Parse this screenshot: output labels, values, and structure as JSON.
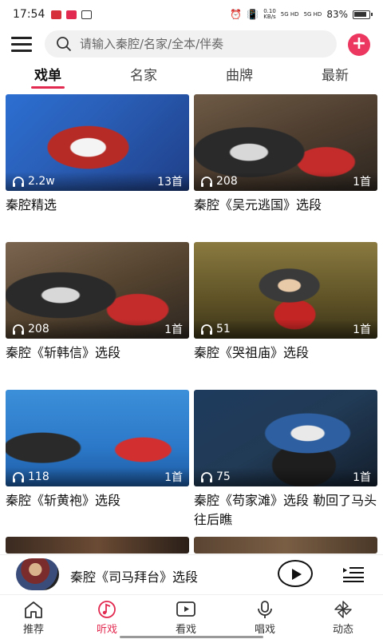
{
  "status_bar": {
    "time": "17:54",
    "net_speed_top": "0.10",
    "net_speed_unit": "KB/s",
    "signal1": "5G HD",
    "signal2": "5G HD",
    "battery": "83%"
  },
  "search": {
    "placeholder": "请输入秦腔/名家/全本/伴奏"
  },
  "tabs": [
    {
      "label": "戏单",
      "active": true
    },
    {
      "label": "名家",
      "active": false
    },
    {
      "label": "曲牌",
      "active": false
    },
    {
      "label": "最新",
      "active": false
    }
  ],
  "playlists": [
    {
      "listens": "2.2w",
      "count": "13首",
      "title": "秦腔精选"
    },
    {
      "listens": "208",
      "count": "1首",
      "title": "秦腔《吴元逃国》选段"
    },
    {
      "listens": "208",
      "count": "1首",
      "title": "秦腔《斩韩信》选段"
    },
    {
      "listens": "51",
      "count": "1首",
      "title": "秦腔《哭祖庙》选段"
    },
    {
      "listens": "118",
      "count": "1首",
      "title": "秦腔《斩黄袍》选段"
    },
    {
      "listens": "75",
      "count": "1首",
      "title": "秦腔《苟家滩》选段 勒回了马头往后瞧"
    }
  ],
  "now_playing": {
    "title": "秦腔《司马拜台》选段"
  },
  "bottom_nav": [
    {
      "label": "推荐",
      "icon": "home-icon",
      "active": false
    },
    {
      "label": "听戏",
      "icon": "music-note-icon",
      "active": true
    },
    {
      "label": "看戏",
      "icon": "video-play-icon",
      "active": false
    },
    {
      "label": "唱戏",
      "icon": "microphone-icon",
      "active": false
    },
    {
      "label": "动态",
      "icon": "pinwheel-icon",
      "active": false
    }
  ],
  "colors": {
    "accent": "#e2294f",
    "add_button": "#ec3760"
  }
}
